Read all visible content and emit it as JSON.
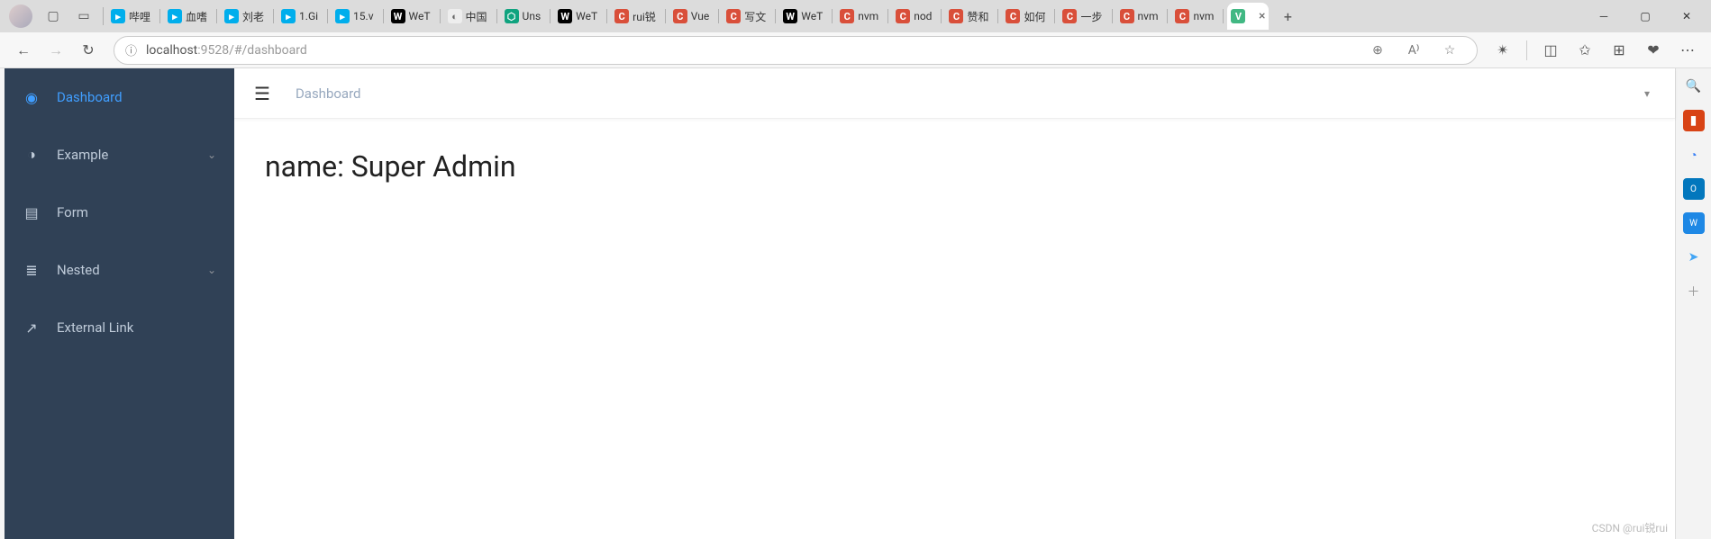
{
  "browser": {
    "tabs": [
      {
        "fav": "bili",
        "label": "哔哩"
      },
      {
        "fav": "bili",
        "label": "血嗜"
      },
      {
        "fav": "bili",
        "label": "刘老"
      },
      {
        "fav": "bili",
        "label": "1.Gi"
      },
      {
        "fav": "bili",
        "label": "15.v"
      },
      {
        "fav": "w",
        "label": "WeT"
      },
      {
        "fav": "g",
        "label": "中国"
      },
      {
        "fav": "o",
        "label": "Uns"
      },
      {
        "fav": "w",
        "label": "WeT"
      },
      {
        "fav": "c",
        "label": "rui锐"
      },
      {
        "fav": "c",
        "label": "Vue"
      },
      {
        "fav": "c",
        "label": "写文"
      },
      {
        "fav": "w",
        "label": "WeT"
      },
      {
        "fav": "c",
        "label": "nvm"
      },
      {
        "fav": "c",
        "label": "nod"
      },
      {
        "fav": "c",
        "label": "赞和"
      },
      {
        "fav": "c",
        "label": "如何"
      },
      {
        "fav": "c",
        "label": "一步"
      },
      {
        "fav": "c",
        "label": "nvm"
      },
      {
        "fav": "c",
        "label": "nvm"
      }
    ],
    "active_tab": {
      "fav": "v",
      "label": ""
    },
    "url_host": "localhost",
    "url_path": ":9528/#/dashboard"
  },
  "sidebar": {
    "items": [
      {
        "icon": "dashboard-icon",
        "label": "Dashboard",
        "active": true,
        "chev": false
      },
      {
        "icon": "example-icon",
        "label": "Example",
        "active": false,
        "chev": true
      },
      {
        "icon": "form-icon",
        "label": "Form",
        "active": false,
        "chev": false
      },
      {
        "icon": "nested-icon",
        "label": "Nested",
        "active": false,
        "chev": true
      },
      {
        "icon": "link-icon",
        "label": "External Link",
        "active": false,
        "chev": false
      }
    ]
  },
  "navbar": {
    "breadcrumb": "Dashboard"
  },
  "content": {
    "heading": "name: Super Admin"
  },
  "watermark": "CSDN @rui锐rui",
  "edge_sidebar": {
    "items": [
      "search",
      "briefcase",
      "copilot",
      "outlook",
      "word",
      "send",
      "plus"
    ]
  }
}
